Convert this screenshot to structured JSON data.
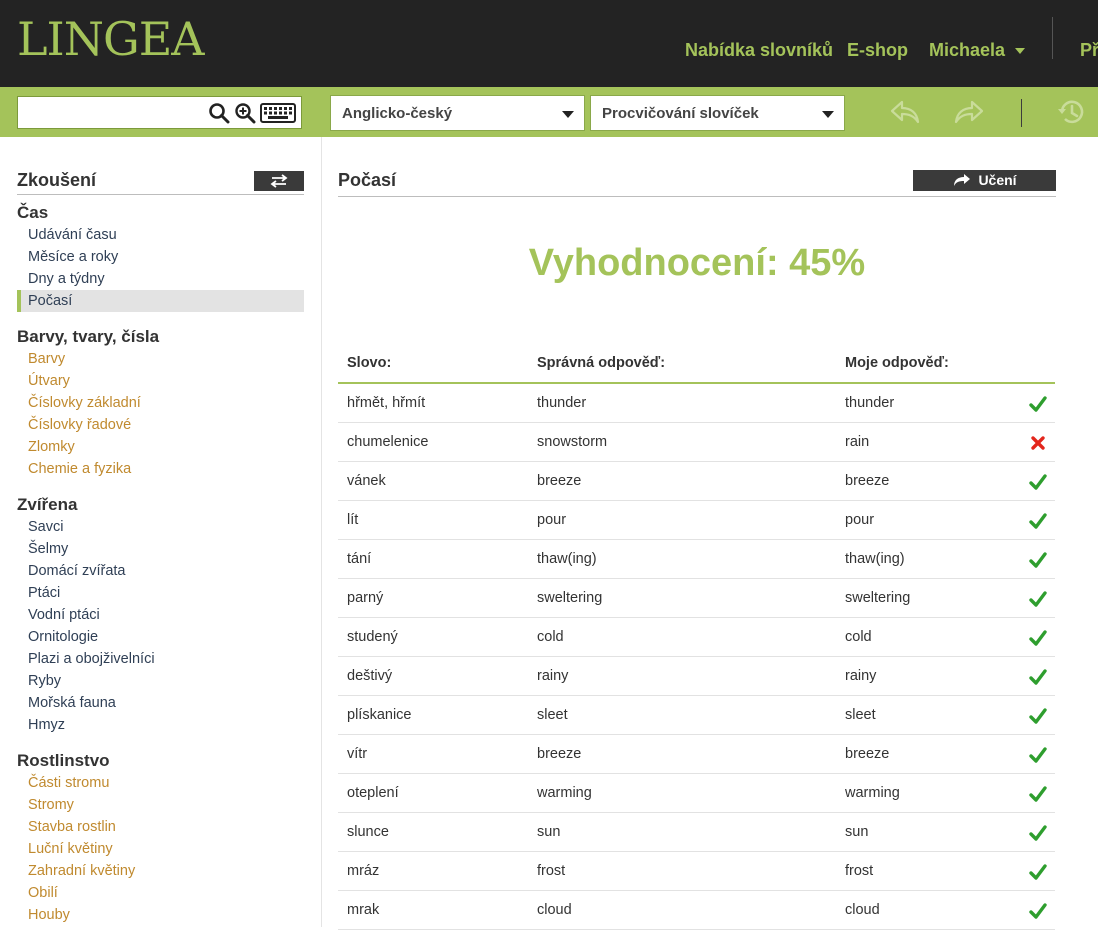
{
  "header": {
    "logo": "LINGEA",
    "nav": [
      "Nabídka slovníků",
      "E-shop",
      "Michaela",
      "Př"
    ],
    "accent_color": "#a4c35a"
  },
  "toolbar": {
    "search_value": "",
    "icons": [
      "search-icon",
      "zoom-in-icon",
      "keyboard-icon",
      "back-icon",
      "forward-icon",
      "history-icon"
    ],
    "dictionary_select": "Anglicko-český",
    "mode_select": "Procvičování slovíček"
  },
  "sidebar": {
    "heading": "Zkoušení",
    "categories": [
      {
        "name": "Čas",
        "items": [
          "Udávání času",
          "Měsíce a roky",
          "Dny a týdny",
          "Počasí"
        ]
      },
      {
        "name": "Barvy, tvary, čísla",
        "items": [
          "Barvy",
          "Útvary",
          "Číslovky základní",
          "Číslovky řadové",
          "Zlomky",
          "Chemie a fyzika"
        ]
      },
      {
        "name": "Zvířena",
        "items": [
          "Savci",
          "Šelmy",
          "Domácí zvířata",
          "Ptáci",
          "Vodní ptáci",
          "Ornitologie",
          "Plazi a obojživelníci",
          "Ryby",
          "Mořská fauna",
          "Hmyz"
        ]
      },
      {
        "name": "Rostlinstvo",
        "items": [
          "Části stromu",
          "Stromy",
          "Stavba rostlin",
          "Luční květiny",
          "Zahradní květiny",
          "Obilí",
          "Houby"
        ]
      }
    ],
    "active_item": "Počasí"
  },
  "main": {
    "title": "Počasí",
    "learn_button": "Učení",
    "score_text": "Vyhodnocení: 45%"
  },
  "results": {
    "headers": [
      "Slovo:",
      "Správná odpověď:",
      "Moje odpověď:"
    ],
    "rows": [
      {
        "word": "hřmět, hřmít",
        "correct": "thunder",
        "mine": "thunder",
        "ok": true
      },
      {
        "word": "chumelenice",
        "correct": "snowstorm",
        "mine": "rain",
        "ok": false
      },
      {
        "word": "vánek",
        "correct": "breeze",
        "mine": "breeze",
        "ok": true
      },
      {
        "word": "lít",
        "correct": "pour",
        "mine": "pour",
        "ok": true
      },
      {
        "word": "tání",
        "correct": "thaw(ing)",
        "mine": "thaw(ing)",
        "ok": true
      },
      {
        "word": "parný",
        "correct": "sweltering",
        "mine": "sweltering",
        "ok": true
      },
      {
        "word": "studený",
        "correct": "cold",
        "mine": "cold",
        "ok": true
      },
      {
        "word": "deštivý",
        "correct": "rainy",
        "mine": "rainy",
        "ok": true
      },
      {
        "word": "plískanice",
        "correct": "sleet",
        "mine": "sleet",
        "ok": true
      },
      {
        "word": "vítr",
        "correct": "breeze",
        "mine": "breeze",
        "ok": true
      },
      {
        "word": "oteplení",
        "correct": "warming",
        "mine": "warming",
        "ok": true
      },
      {
        "word": "slunce",
        "correct": "sun",
        "mine": "sun",
        "ok": true
      },
      {
        "word": "mráz",
        "correct": "frost",
        "mine": "frost",
        "ok": true
      },
      {
        "word": "mrak",
        "correct": "cloud",
        "mine": "cloud",
        "ok": true
      }
    ]
  }
}
